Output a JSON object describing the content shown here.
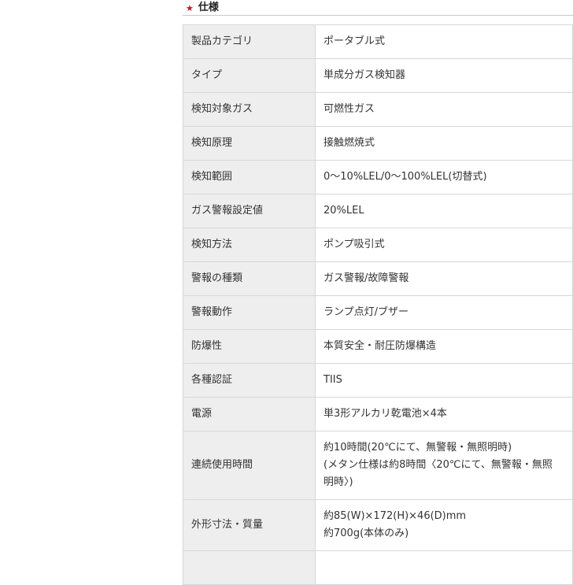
{
  "section": {
    "title": "仕様",
    "star": "★"
  },
  "spec_rows": [
    {
      "label": "製品カテゴリ",
      "lines": [
        "ポータブル式"
      ]
    },
    {
      "label": "タイプ",
      "lines": [
        "単成分ガス検知器"
      ]
    },
    {
      "label": "検知対象ガス",
      "lines": [
        "可燃性ガス"
      ]
    },
    {
      "label": "検知原理",
      "lines": [
        "接触燃焼式"
      ]
    },
    {
      "label": "検知範囲",
      "lines": [
        "0～10%LEL/0～100%LEL(切替式)"
      ]
    },
    {
      "label": "ガス警報設定値",
      "lines": [
        "20%LEL"
      ]
    },
    {
      "label": "検知方法",
      "lines": [
        "ポンプ吸引式"
      ]
    },
    {
      "label": "警報の種類",
      "lines": [
        "ガス警報/故障警報"
      ]
    },
    {
      "label": "警報動作",
      "lines": [
        "ランプ点灯/ブザー"
      ]
    },
    {
      "label": "防爆性",
      "lines": [
        "本質安全・耐圧防爆構造"
      ]
    },
    {
      "label": "各種認証",
      "lines": [
        "TIIS"
      ]
    },
    {
      "label": "電源",
      "lines": [
        "単3形アルカリ乾電池×4本"
      ]
    },
    {
      "label": "連続使用時間",
      "lines": [
        "約10時間(20℃にて、無警報・無照明時)",
        "(メタン仕様は約8時間〈20℃にて、無警報・無照",
        "明時〉)"
      ]
    },
    {
      "label": "外形寸法・質量",
      "lines": [
        "約85(W)×172(H)×46(D)mm",
        "約700g(本体のみ)"
      ]
    },
    {
      "label": "",
      "lines": [
        ""
      ]
    }
  ]
}
